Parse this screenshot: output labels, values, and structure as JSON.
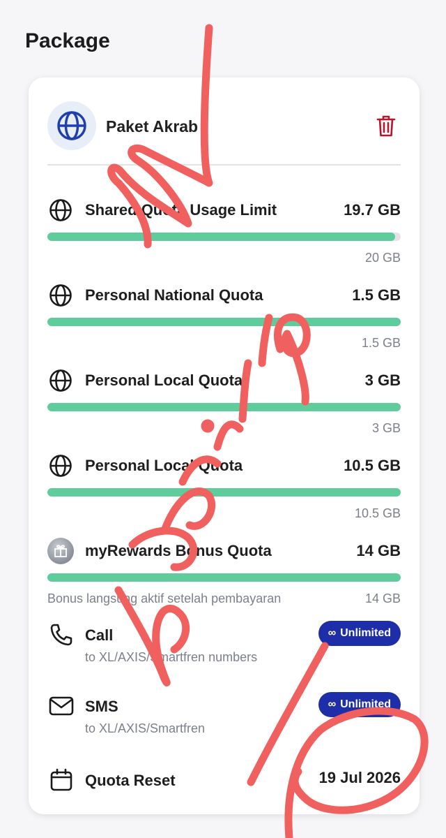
{
  "page": {
    "title": "Package"
  },
  "package": {
    "name": "Paket Akrab",
    "icon": "globe-icon",
    "delete_icon": "trash-icon"
  },
  "quotas": [
    {
      "name": "Shared Quota Usage Limit",
      "amount": "19.7 GB",
      "total": "20 GB",
      "fill_percent": 98.5,
      "icon": "globe-icon"
    },
    {
      "name": "Personal National Quota",
      "amount": "1.5 GB",
      "total": "1.5 GB",
      "fill_percent": 100,
      "icon": "globe-icon"
    },
    {
      "name": "Personal Local Quota",
      "amount": "3 GB",
      "total": "3 GB",
      "fill_percent": 100,
      "icon": "globe-icon"
    },
    {
      "name": "Personal Local Quota",
      "amount": "10.5 GB",
      "total": "10.5 GB",
      "fill_percent": 100,
      "icon": "globe-icon"
    },
    {
      "name": "myRewards Bonus Quota",
      "amount": "14 GB",
      "total": "14 GB",
      "note": "Bonus langsung aktif setelah pembayaran",
      "fill_percent": 100,
      "icon": "gift-icon"
    }
  ],
  "services": [
    {
      "name": "Call",
      "subtitle": "to XL/AXIS/Smartfren numbers",
      "badge": "Unlimited",
      "badge_icon": "infinity-icon",
      "icon": "phone-icon"
    },
    {
      "name": "SMS",
      "subtitle": "to XL/AXIS/Smartfren",
      "badge": "Unlimited",
      "badge_icon": "infinity-icon",
      "icon": "mail-icon"
    }
  ],
  "reset": {
    "label": "Quota Reset",
    "date": "19 Jul 2026",
    "icon": "calendar-icon"
  },
  "colors": {
    "progress": "#5fcc9c",
    "badge": "#1e2ea8",
    "globe_accent": "#1f3fb0",
    "trash": "#b5172f",
    "scribble": "#f0605e"
  }
}
